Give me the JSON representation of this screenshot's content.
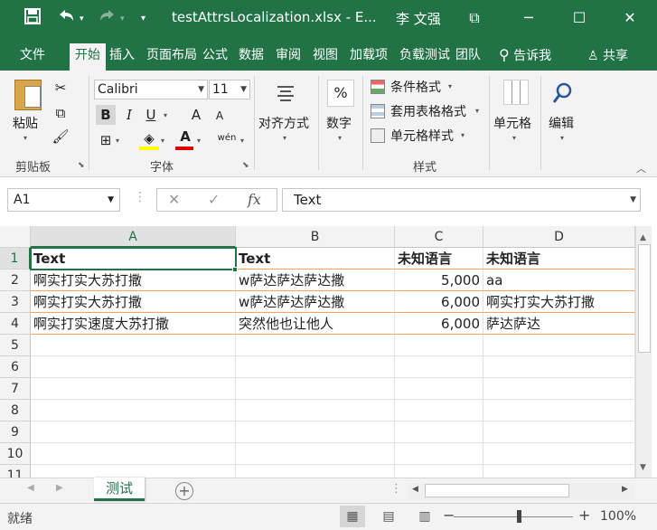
{
  "window": {
    "title": "testAttrsLocalization.xlsx - E...",
    "user": "李 文强",
    "minimize": "─",
    "maximize": "☐",
    "close": "✕",
    "ribbon_display": "⧉"
  },
  "quick_access": {
    "save_icon": "save-icon",
    "undo_icon": "undo-icon",
    "redo_icon": "redo-icon",
    "customize": "▾"
  },
  "ribbon_tabs": [
    {
      "label": "文件"
    },
    {
      "label": "开始",
      "active": true
    },
    {
      "label": "插入"
    },
    {
      "label": "页面布局"
    },
    {
      "label": "公式"
    },
    {
      "label": "数据"
    },
    {
      "label": "审阅"
    },
    {
      "label": "视图"
    },
    {
      "label": "加载项"
    },
    {
      "label": "负载测试"
    },
    {
      "label": "团队"
    }
  ],
  "tell_me": "告诉我",
  "share": "共享",
  "ribbon": {
    "clipboard": {
      "paste": "粘贴",
      "group": "剪贴板"
    },
    "font": {
      "name": "Calibri",
      "size": "11",
      "bold": "B",
      "italic": "I",
      "underline": "U",
      "grow": "A",
      "shrink": "A",
      "font_color": "A",
      "phonetic": "wén",
      "group": "字体"
    },
    "alignment": {
      "label": "对齐方式"
    },
    "number": {
      "label": "数字",
      "symbol": "%"
    },
    "styles": {
      "conditional": "条件格式",
      "table": "套用表格格式",
      "cell_styles": "单元格样式",
      "group": "样式"
    },
    "cells": {
      "label": "单元格"
    },
    "editing": {
      "label": "编辑"
    },
    "accent_color": "#217346",
    "highlight_color": "#ffff00",
    "font_color_bar": "#e00000"
  },
  "formula_bar": {
    "name_box": "A1",
    "content": "Text",
    "cancel": "✕",
    "enter": "✓",
    "fx": "fx"
  },
  "sheet": {
    "columns": [
      "A",
      "B",
      "C",
      "D"
    ],
    "rows": [
      "1",
      "2",
      "3",
      "4",
      "5",
      "6",
      "7",
      "8",
      "9",
      "10",
      "11"
    ],
    "cells": [
      [
        "Text",
        "Text",
        "未知语言",
        "未知语言"
      ],
      [
        "啊实打实大苏打撒",
        "w萨达萨达萨达撒",
        "5,000",
        "aa"
      ],
      [
        "啊实打实大苏打撒",
        "w萨达萨达萨达撒",
        "6,000",
        "啊实打实大苏打撒"
      ],
      [
        "啊实打实速度大苏打撒",
        "突然他也让他人",
        "6,000",
        "萨达萨达"
      ]
    ],
    "selected_cell": "A1"
  },
  "sheet_tabs": [
    {
      "label": "测试",
      "active": true
    }
  ],
  "status": {
    "ready": "就绪",
    "zoom": "100%",
    "zoom_minus": "−",
    "zoom_plus": "+"
  }
}
